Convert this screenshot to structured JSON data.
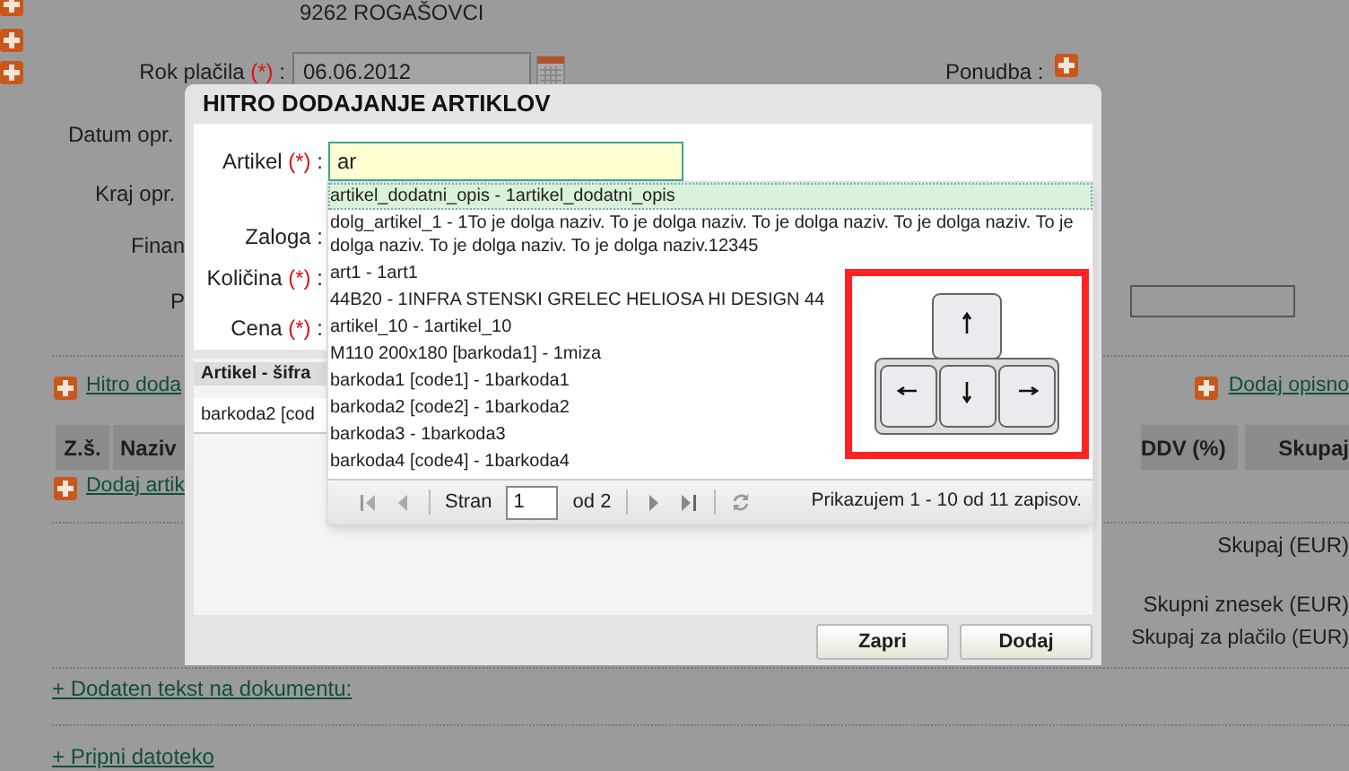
{
  "page": {
    "address": "9262 ROGAŠOVCI",
    "due_date": {
      "label": "Rok plačila",
      "mark": "(*)",
      "sep": ":",
      "value": "06.06.2012"
    },
    "offer_label": "Ponudba :",
    "cut_labels": [
      "Datum opr.",
      "Kraj opr.",
      "Finan",
      "P"
    ],
    "quick_add_link": "Hitro doda",
    "description_link": "Dodaj opisno",
    "columns_left": [
      "Z.š.",
      "Naziv"
    ],
    "columns_right": [
      "DDV (%)",
      "Skupaj"
    ],
    "add_item_link": "Dodaj artik",
    "totals": [
      "Skupaj (EUR)",
      "Skupni znesek (EUR)",
      "Skupaj za plačilo (EUR)"
    ],
    "bottom_links": [
      "+ Dodaten tekst na dokumentu:",
      "+ Pripni datoteko"
    ]
  },
  "dialog": {
    "title": "HITRO DODAJANJE ARTIKLOV",
    "fields": [
      {
        "label": "Artikel",
        "mark": "(*)",
        "sep": ":",
        "value": "ar"
      },
      {
        "label": "Zaloga",
        "sep": ":"
      },
      {
        "label": "Količina",
        "mark": "(*)",
        "sep": ":"
      },
      {
        "label": "Cena",
        "mark": "(*)",
        "sep": ":"
      }
    ],
    "grid": {
      "column": "Artikel - šifra",
      "rows": [
        "barkoda2 [cod"
      ]
    },
    "suggestions": [
      {
        "text": "artikel_dodatni_opis - 1artikel_dodatni_opis",
        "selected": true
      },
      {
        "text": "dolg_artikel_1 - 1To je dolga naziv. To je dolga naziv. To je dolga naziv. To je dolga naziv. To je dolga naziv. To je dolga naziv. To je dolga naziv.12345",
        "selected": false
      },
      {
        "text": "art1 - 1art1",
        "selected": false
      },
      {
        "text": "44B20 - 1INFRA STENSKI GRELEC HELIOSA HI DESIGN 44",
        "selected": false
      },
      {
        "text": "artikel_10 - 1artikel_10",
        "selected": false
      },
      {
        "text": "M110 200x180 [barkoda1] - 1miza",
        "selected": false
      },
      {
        "text": "barkoda1 [code1] - 1barkoda1",
        "selected": false
      },
      {
        "text": "barkoda2 [code2] - 1barkoda2",
        "selected": false
      },
      {
        "text": "barkoda3 - 1barkoda3",
        "selected": false
      },
      {
        "text": "barkoda4 [code4] - 1barkoda4",
        "selected": false
      }
    ],
    "pager": {
      "page_label": "Stran",
      "page": "1",
      "of": "od 2",
      "summary": "Prikazujem 1 - 10 od 11 zapisov."
    },
    "buttons": [
      "Zapri",
      "Dodaj"
    ]
  }
}
